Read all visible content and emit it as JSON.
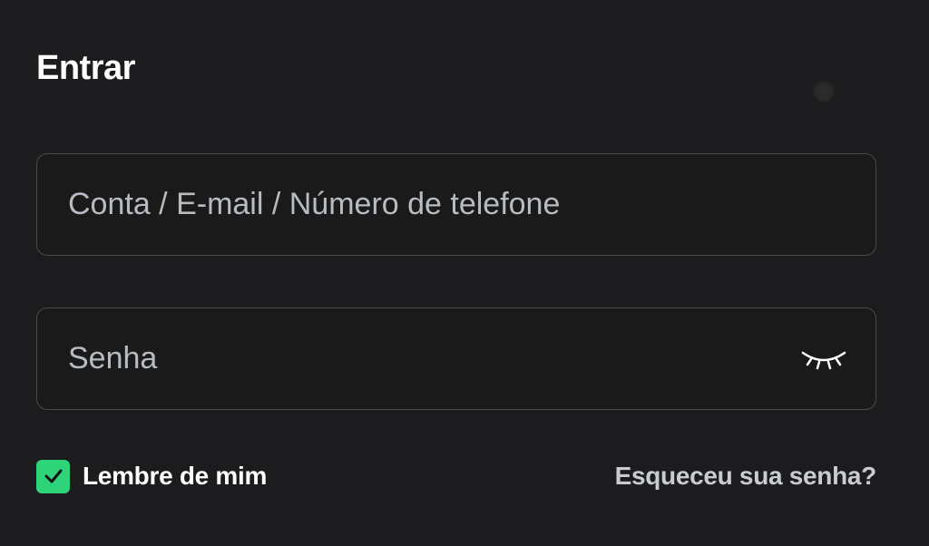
{
  "login": {
    "title": "Entrar",
    "account_field": {
      "placeholder": "Conta / E-mail / Número de telefone",
      "value": ""
    },
    "password_field": {
      "placeholder": "Senha",
      "value": "",
      "visibility_icon": "eye-closed-icon"
    },
    "remember_me": {
      "label": "Lembre de mim",
      "checked": true
    },
    "forgot_password_label": "Esqueceu sua senha?"
  },
  "colors": {
    "background": "#1c1c1e",
    "field_border": "#4a4a4c",
    "checkbox_accent": "#2ed47a",
    "placeholder_text": "#b7bcc2",
    "link_text": "#c8ccd2"
  }
}
